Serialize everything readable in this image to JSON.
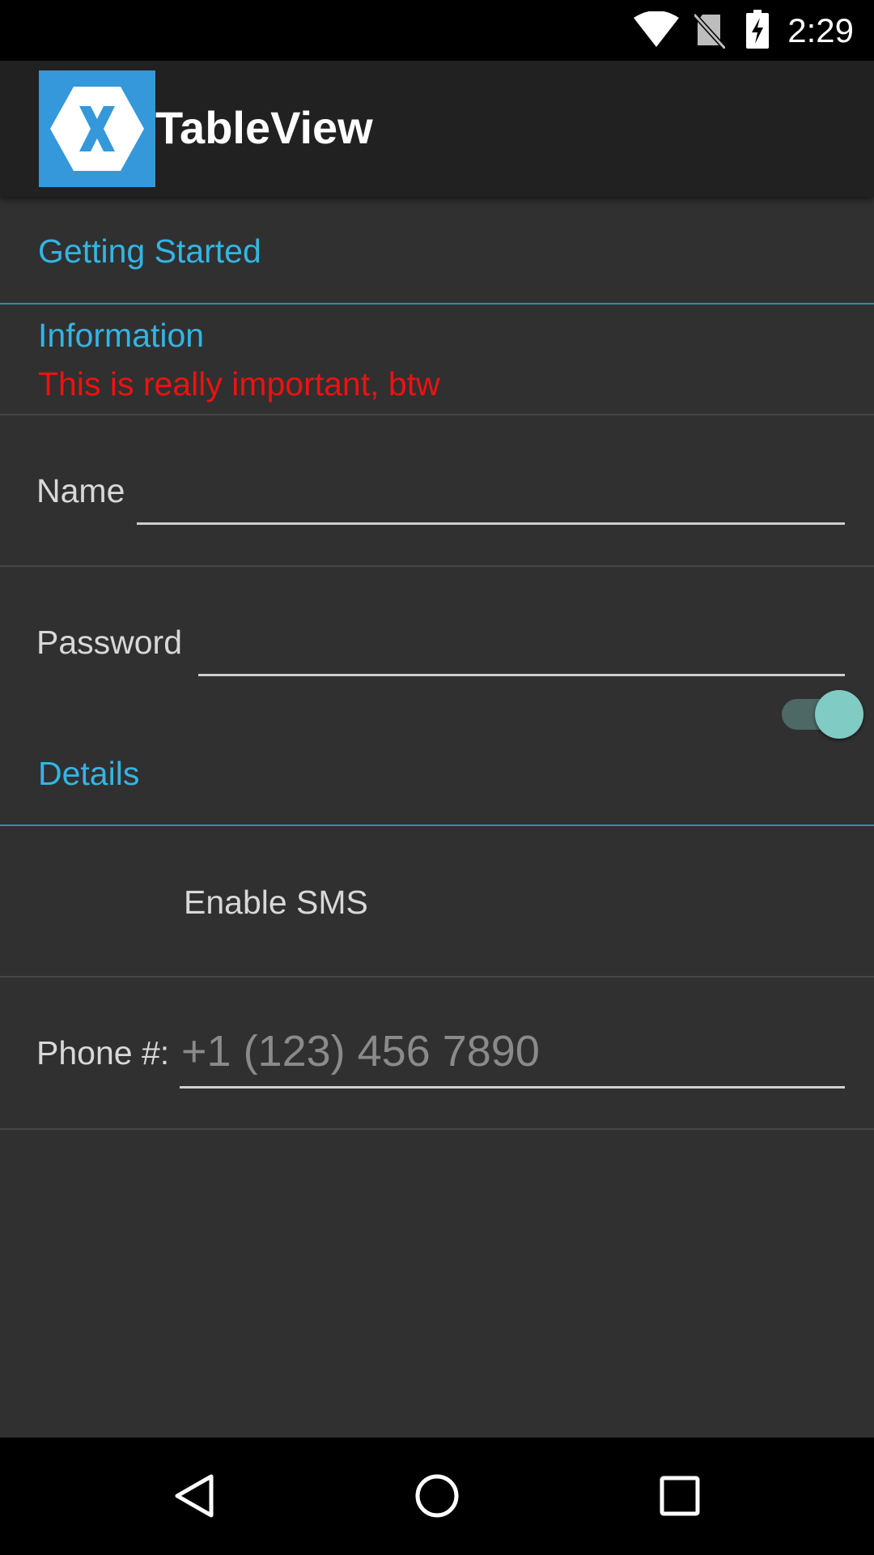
{
  "status_bar": {
    "time": "2:29",
    "icons": [
      "wifi-icon",
      "no-sim-icon",
      "battery-charging-icon"
    ]
  },
  "app_bar": {
    "logo_icon": "xamarin-logo",
    "title": "TableView"
  },
  "sections": {
    "getting_started": "Getting Started",
    "details": "Details"
  },
  "info_cell": {
    "title": "Information",
    "detail": "This is really important, btw"
  },
  "name_entry": {
    "label": "Name",
    "value": "",
    "placeholder": ""
  },
  "password_entry": {
    "label": "Password",
    "value": "",
    "placeholder": ""
  },
  "sms_switch": {
    "label": "Enable SMS",
    "on": true
  },
  "phone_entry": {
    "label": "Phone #:",
    "value": "",
    "placeholder": "+1 (123) 456 7890"
  },
  "nav_bar": {
    "icons": [
      "back-icon",
      "home-icon",
      "recents-icon"
    ]
  },
  "colors": {
    "accent": "#33b5e5",
    "detail": "#ee1111",
    "background": "#303030",
    "app_bar": "#212121",
    "logo": "#3498db",
    "switch_thumb": "#80cbc4"
  }
}
